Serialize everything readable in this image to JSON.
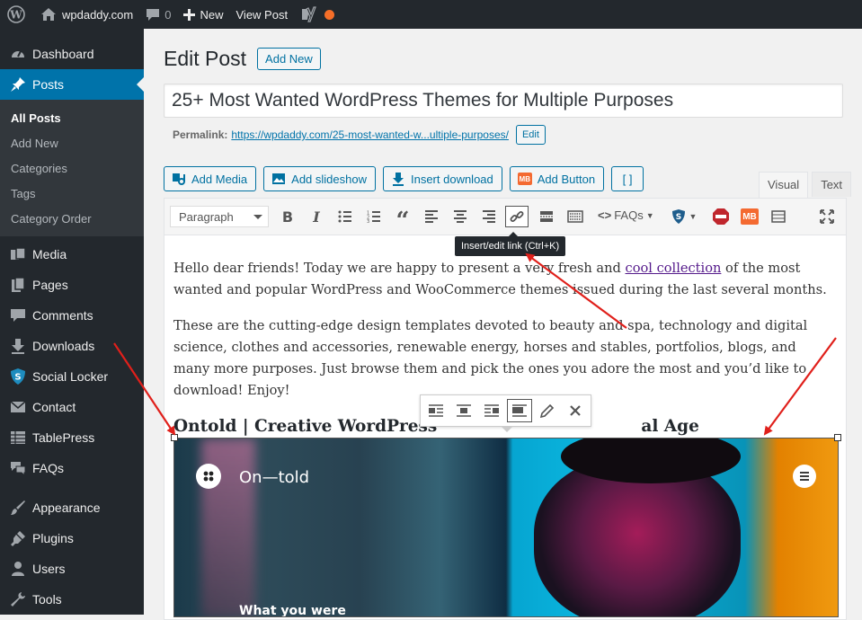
{
  "adminbar": {
    "site_name": "wpdaddy.com",
    "comments_count": "0",
    "new_label": "New",
    "view_post_label": "View Post"
  },
  "sidebar": {
    "items": [
      {
        "label": "Dashboard",
        "icon": "dashboard-icon"
      },
      {
        "label": "Posts",
        "icon": "pin-icon",
        "active": true
      },
      {
        "label": "Media",
        "icon": "media-icon"
      },
      {
        "label": "Pages",
        "icon": "pages-icon"
      },
      {
        "label": "Comments",
        "icon": "comments-icon"
      },
      {
        "label": "Downloads",
        "icon": "download-icon"
      },
      {
        "label": "Social Locker",
        "icon": "shield-icon"
      },
      {
        "label": "Contact",
        "icon": "mail-icon"
      },
      {
        "label": "TablePress",
        "icon": "table-icon"
      },
      {
        "label": "FAQs",
        "icon": "faq-icon"
      },
      {
        "label": "Appearance",
        "icon": "brush-icon"
      },
      {
        "label": "Plugins",
        "icon": "plugin-icon"
      },
      {
        "label": "Users",
        "icon": "users-icon"
      },
      {
        "label": "Tools",
        "icon": "tools-icon"
      }
    ],
    "submenu": [
      "All Posts",
      "Add New",
      "Categories",
      "Tags",
      "Category Order"
    ]
  },
  "page": {
    "title": "Edit Post",
    "add_new": "Add New",
    "post_title": "25+ Most Wanted WordPress Themes for Multiple Purposes",
    "permalink_label": "Permalink:",
    "permalink_url": "https://wpdaddy.com/25-most-wanted-w...ultiple-purposes/",
    "permalink_edit": "Edit"
  },
  "media_buttons": {
    "add_media": "Add Media",
    "add_slideshow": "Add slideshow",
    "insert_download": "Insert download",
    "add_button": "Add Button",
    "shortcode": "[ ]",
    "mb_badge": "MB"
  },
  "tabs": {
    "visual": "Visual",
    "text": "Text"
  },
  "toolbar": {
    "format": "Paragraph",
    "faqs": "FAQs",
    "tooltip": "Insert/edit link (Ctrl+K)",
    "mb_badge": "MB"
  },
  "content": {
    "p1_before": "Hello dear friends! Today we are happy to present a very fresh and ",
    "p1_link": "cool collection",
    "p1_after": " of the most wanted and popular WordPress and WooCommerce themes issued during the last several months.",
    "p2": "These are the cutting-edge design templates devoted to beauty and spa, technology and digital science, clothes and accessories, renewable energy, horses and stables, portfolios, blogs, and many more purposes. Just browse them and pick the ones you adore the most and you’d like to download! Enjoy!",
    "h3_left": "Ontold | Creative WordPress",
    "h3_right": "al Age",
    "hero_brand": "On—told",
    "hero_tagline": "What you were"
  },
  "colors": {
    "admin_dark": "#23282d",
    "accent_blue": "#0073aa",
    "annotation_red": "#e0201b",
    "notification_orange": "#f56e28"
  }
}
